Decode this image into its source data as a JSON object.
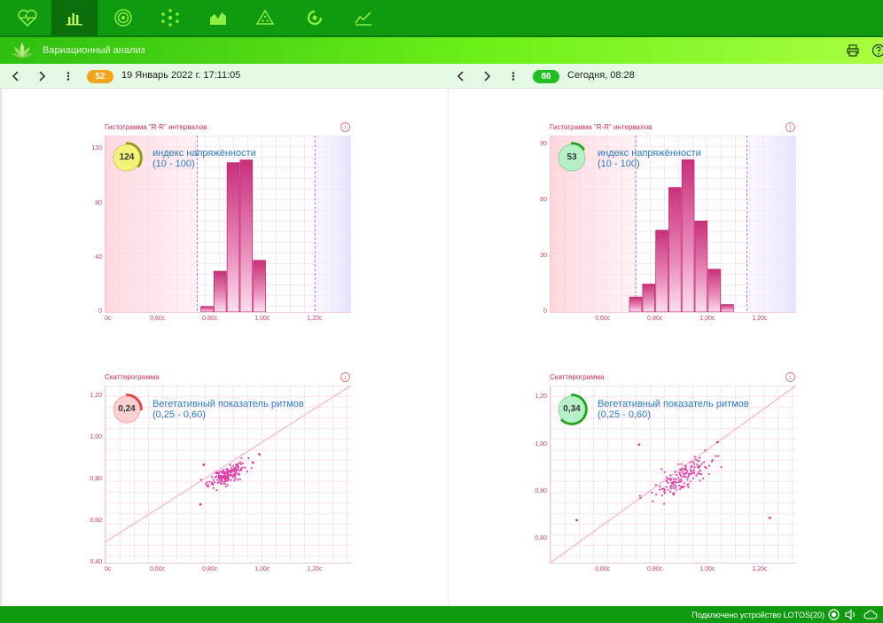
{
  "header": {
    "title": "Вариационный анализ"
  },
  "status": {
    "text": "Подключено устройство LOTOS(20)"
  },
  "sessions": [
    {
      "badge": "52",
      "badge_color": "#f5a418",
      "date": "19 Январь 2022 г. 17:11:05"
    },
    {
      "badge": "86",
      "badge_color": "#1fc01f",
      "date": "Сегодня, 08:28"
    }
  ],
  "charts": {
    "left_hist": {
      "title": "Гистограмма \"R-R\" интервалов",
      "index_label": "индекс напряжённости",
      "index_range": "(10 - 100)",
      "index_value": "124",
      "gauge_fill": "#f5f27a",
      "gauge_arc": "#8a9c12",
      "gauge_frac": 0.35
    },
    "right_hist": {
      "title": "Гистограмма \"R-R\" интервалов",
      "index_label": "индекс напряжённости",
      "index_range": "(10 - 100)",
      "index_value": "53",
      "gauge_fill": "#b6f0c8",
      "gauge_arc": "#16a316",
      "gauge_frac": 0.15
    },
    "left_scatter": {
      "title": "Скаттерограмма",
      "index_label": "Вегетативный показатель ритмов",
      "index_range": "(0,25 - 0,60)",
      "index_value": "0,24",
      "gauge_fill": "#fbd0d0",
      "gauge_arc": "#e23a3a",
      "gauge_frac": 0.25
    },
    "right_scatter": {
      "title": "Скаттерограмма",
      "index_label": "Вегетативный показатель ритмов",
      "index_range": "(0,25 - 0,60)",
      "index_value": "0,34",
      "gauge_fill": "#b6f0c8",
      "gauge_arc": "#16a316",
      "gauge_frac": 0.62
    }
  },
  "chart_data": [
    {
      "type": "bar",
      "id": "left_hist",
      "title": "Гистограмма \"R-R\" интервалов",
      "xlim": [
        0.5,
        1.25
      ],
      "ylim": [
        0,
        130
      ],
      "x_ticks": [
        "0с",
        "0,60с",
        "0,80с",
        "1,00с",
        "1,20с"
      ],
      "x_tick_values": [
        0.5,
        0.7,
        0.9,
        1.1,
        1.3
      ],
      "y_ticks": [
        "0",
        "40",
        "80",
        "120"
      ],
      "y_tick_values": [
        0,
        40,
        80,
        120
      ],
      "bars": [
        {
          "x0": 0.79,
          "x1": 0.83,
          "value": 4
        },
        {
          "x0": 0.83,
          "x1": 0.87,
          "value": 30
        },
        {
          "x0": 0.87,
          "x1": 0.91,
          "value": 110
        },
        {
          "x0": 0.91,
          "x1": 0.95,
          "value": 112
        },
        {
          "x0": 0.95,
          "x1": 0.99,
          "value": 38
        }
      ],
      "zones": {
        "low": [
          0.5,
          0.78
        ],
        "high": [
          1.14,
          1.25
        ]
      },
      "markers": [
        0.78,
        1.14
      ]
    },
    {
      "type": "bar",
      "id": "right_hist",
      "title": "Гистограмма \"R-R\" интервалов",
      "xlim": [
        0.5,
        1.25
      ],
      "ylim": [
        0,
        95
      ],
      "x_ticks": [
        "0,60с",
        "0,80с",
        "1,00с",
        "1,20с"
      ],
      "x_tick_values": [
        0.7,
        0.9,
        1.1,
        1.3
      ],
      "y_ticks": [
        "0",
        "30",
        "60",
        "90"
      ],
      "y_tick_values": [
        0,
        30,
        60,
        90
      ],
      "bars": [
        {
          "x0": 0.74,
          "x1": 0.78,
          "value": 8
        },
        {
          "x0": 0.78,
          "x1": 0.82,
          "value": 15
        },
        {
          "x0": 0.82,
          "x1": 0.86,
          "value": 44
        },
        {
          "x0": 0.86,
          "x1": 0.9,
          "value": 67
        },
        {
          "x0": 0.9,
          "x1": 0.94,
          "value": 82
        },
        {
          "x0": 0.94,
          "x1": 0.98,
          "value": 49
        },
        {
          "x0": 0.98,
          "x1": 1.02,
          "value": 23
        },
        {
          "x0": 1.02,
          "x1": 1.06,
          "value": 4
        }
      ],
      "zones": {
        "low": [
          0.5,
          0.76
        ],
        "high": [
          1.1,
          1.25
        ]
      },
      "markers": [
        0.76,
        1.1
      ]
    },
    {
      "type": "scatter",
      "id": "left_scatter",
      "title": "Скаттерограмма",
      "xlim": [
        0.5,
        1.25
      ],
      "ylim": [
        0.4,
        1.25
      ],
      "x_ticks": [
        "0с",
        "0,60с",
        "0,80с",
        "1,00с",
        "1,20с"
      ],
      "x_tick_values": [
        0.5,
        0.7,
        0.9,
        1.1,
        1.3
      ],
      "y_ticks": [
        "0,40",
        "0,60",
        "0,80",
        "1,00",
        "1,20"
      ],
      "y_tick_values": [
        0.4,
        0.6,
        0.8,
        1.0,
        1.2
      ],
      "center": [
        0.87,
        0.82
      ],
      "spread": 0.025,
      "count": 170,
      "points": [
        [
          0.8,
          0.87
        ],
        [
          0.79,
          0.68
        ],
        [
          0.95,
          0.88
        ],
        [
          0.97,
          0.92
        ]
      ]
    },
    {
      "type": "scatter",
      "id": "right_scatter",
      "title": "Скаттерограмма",
      "xlim": [
        0.5,
        1.25
      ],
      "ylim": [
        0.5,
        1.25
      ],
      "x_ticks": [
        "0,60с",
        "0,80с",
        "1,00с",
        "1,20с"
      ],
      "x_tick_values": [
        0.7,
        0.9,
        1.1,
        1.3
      ],
      "y_ticks": [
        "0,60",
        "0,80",
        "1,00",
        "1,20"
      ],
      "y_tick_values": [
        0.6,
        0.8,
        1.0,
        1.2
      ],
      "center": [
        0.91,
        0.87
      ],
      "spread": 0.04,
      "count": 150,
      "points": [
        [
          0.58,
          0.68
        ],
        [
          1.17,
          0.69
        ],
        [
          0.77,
          1.0
        ],
        [
          1.01,
          1.01
        ]
      ]
    }
  ]
}
